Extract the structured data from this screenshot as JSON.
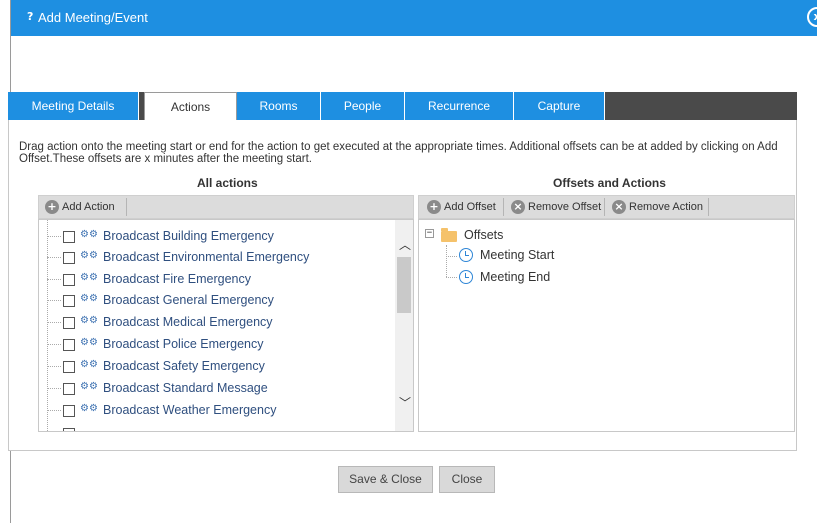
{
  "window": {
    "title": "Add Meeting/Event",
    "help_icon": "?",
    "close_icon": "x"
  },
  "tabs": [
    {
      "label": "Meeting Details"
    },
    {
      "label": "Actions"
    },
    {
      "label": "Rooms"
    },
    {
      "label": "People"
    },
    {
      "label": "Recurrence"
    },
    {
      "label": "Capture"
    }
  ],
  "active_tab": "Actions",
  "instructions": "Drag action onto the meeting start or end for the action to get executed at the appropriate times. Additional offsets can be at added by clicking on Add Offset.These offsets are x minutes after the meeting start.",
  "all_actions": {
    "title": "All actions",
    "toolbar": {
      "add_action_label": "Add Action"
    },
    "items": [
      {
        "label": "Broadcast Building Emergency",
        "checked": false
      },
      {
        "label": "Broadcast Environmental Emergency",
        "checked": false
      },
      {
        "label": "Broadcast Fire Emergency",
        "checked": false
      },
      {
        "label": "Broadcast General Emergency",
        "checked": false
      },
      {
        "label": "Broadcast Medical Emergency",
        "checked": false
      },
      {
        "label": "Broadcast Police Emergency",
        "checked": false
      },
      {
        "label": "Broadcast Safety Emergency",
        "checked": false
      },
      {
        "label": "Broadcast Standard Message",
        "checked": false
      },
      {
        "label": "Broadcast Weather Emergency",
        "checked": false
      }
    ]
  },
  "offsets": {
    "title": "Offsets and Actions",
    "toolbar": {
      "add_offset_label": "Add Offset",
      "remove_offset_label": "Remove Offset",
      "remove_action_label": "Remove Action"
    },
    "tree": {
      "root_label": "Offsets",
      "expander": "−",
      "children": [
        {
          "label": "Meeting Start"
        },
        {
          "label": "Meeting End"
        }
      ]
    }
  },
  "footer": {
    "save_close_label": "Save & Close",
    "close_label": "Close"
  },
  "colors": {
    "accent": "#1e8fe1",
    "tabbar": "#4a4a4a",
    "button": "#d9d9d9"
  }
}
